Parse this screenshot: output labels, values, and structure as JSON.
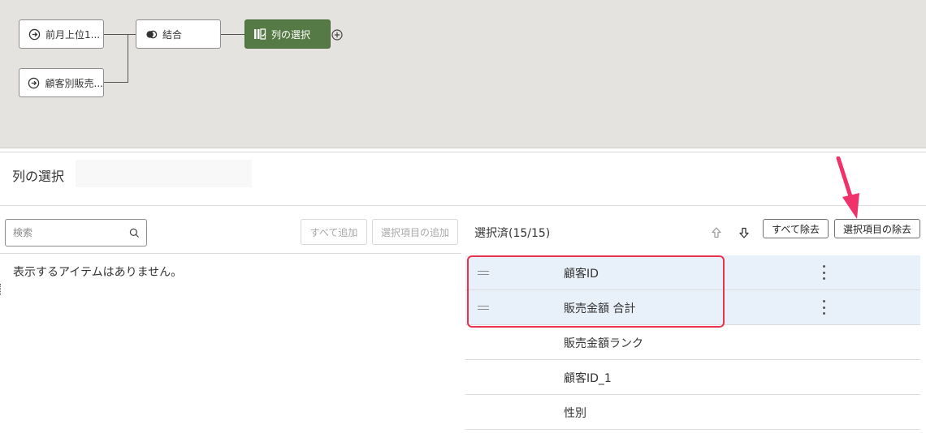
{
  "flow": {
    "nodes": [
      {
        "id": "n1",
        "label": "前月上位1...",
        "icon": "arrow-circle-icon"
      },
      {
        "id": "n2",
        "label": "顧客別販売...",
        "icon": "arrow-circle-icon"
      },
      {
        "id": "n3",
        "label": "結合",
        "icon": "join-icon"
      },
      {
        "id": "n4",
        "label": "列の選択",
        "icon": "select-columns-icon"
      }
    ],
    "add_icon": "plus-circle-icon",
    "accent_color": "#567a45"
  },
  "panel": {
    "title": "列の選択",
    "title_input_value": ""
  },
  "available": {
    "search_placeholder": "検索",
    "add_all_label": "すべて追加",
    "add_selected_label": "選択項目の追加",
    "empty_message": "表示するアイテムはありません。"
  },
  "selected": {
    "count_label": "選択済(15/15)",
    "remove_all_label": "すべて除去",
    "remove_selected_label": "選択項目の除去",
    "rows": [
      {
        "label": "顧客ID",
        "selected": true
      },
      {
        "label": "販売金額 合計",
        "selected": true
      },
      {
        "label": "販売金額ランク",
        "selected": false
      },
      {
        "label": "顧客ID_1",
        "selected": false
      },
      {
        "label": "性別",
        "selected": false
      }
    ],
    "selection_color": "#e8f1f9"
  },
  "annotation": {
    "color": "#e8344e"
  }
}
